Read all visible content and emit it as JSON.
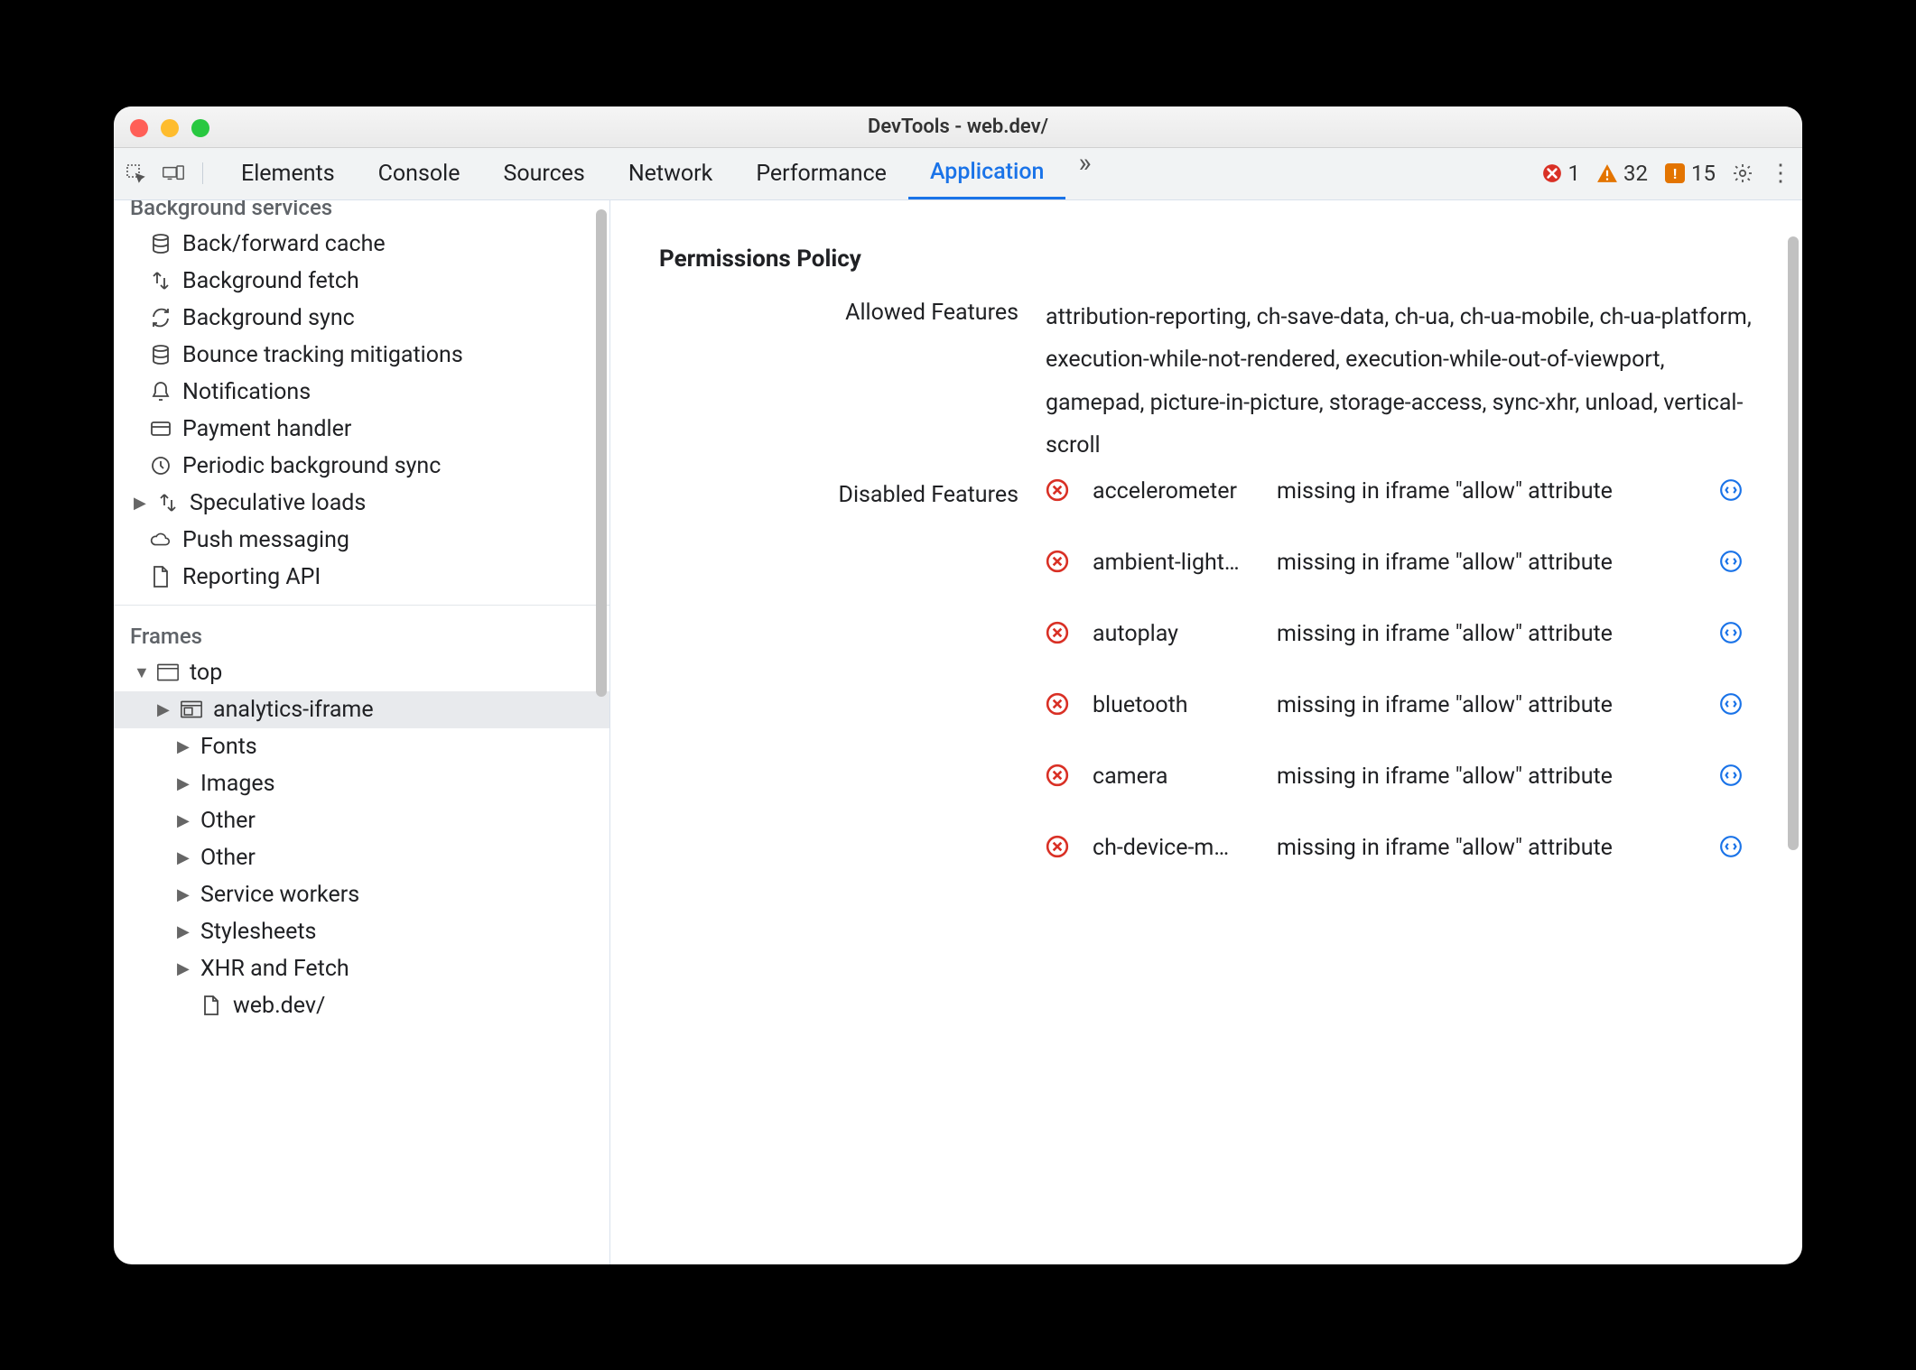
{
  "window": {
    "title": "DevTools - web.dev/"
  },
  "toolbar": {
    "tabs": [
      "Elements",
      "Console",
      "Sources",
      "Network",
      "Performance",
      "Application"
    ],
    "active_tab": "Application",
    "counts": {
      "errors": "1",
      "warnings": "32",
      "issues": "15"
    }
  },
  "sidebar": {
    "sections": {
      "background_services": {
        "title": "Background services",
        "items": [
          {
            "icon": "database-icon",
            "label": "Back/forward cache"
          },
          {
            "icon": "transfer-icon",
            "label": "Background fetch"
          },
          {
            "icon": "sync-icon",
            "label": "Background sync"
          },
          {
            "icon": "database-icon",
            "label": "Bounce tracking mitigations"
          },
          {
            "icon": "bell-icon",
            "label": "Notifications"
          },
          {
            "icon": "card-icon",
            "label": "Payment handler"
          },
          {
            "icon": "clock-icon",
            "label": "Periodic background sync"
          },
          {
            "icon": "transfer-icon",
            "label": "Speculative loads",
            "expandable": true
          },
          {
            "icon": "cloud-icon",
            "label": "Push messaging"
          },
          {
            "icon": "file-icon",
            "label": "Reporting API"
          }
        ]
      },
      "frames": {
        "title": "Frames",
        "top": {
          "label": "top"
        },
        "selected": {
          "label": "analytics-iframe"
        },
        "children": [
          "Fonts",
          "Images",
          "Other",
          "Other",
          "Service workers",
          "Stylesheets",
          "XHR and Fetch"
        ],
        "leaf": {
          "label": "web.dev/"
        }
      }
    }
  },
  "main": {
    "section_title": "Permissions Policy",
    "allowed_label": "Allowed Features",
    "allowed_value": "attribution-reporting, ch-save-data, ch-ua, ch-ua-mobile, ch-ua-platform, execution-while-not-rendered, execution-while-out-of-viewport, gamepad, picture-in-picture, storage-access, sync-xhr, unload, vertical-scroll",
    "disabled_label": "Disabled Features",
    "disabled_reason": "missing in iframe \"allow\" attribute",
    "disabled_features": [
      "accelerometer",
      "ambient-light…",
      "autoplay",
      "bluetooth",
      "camera",
      "ch-device-m…"
    ]
  }
}
